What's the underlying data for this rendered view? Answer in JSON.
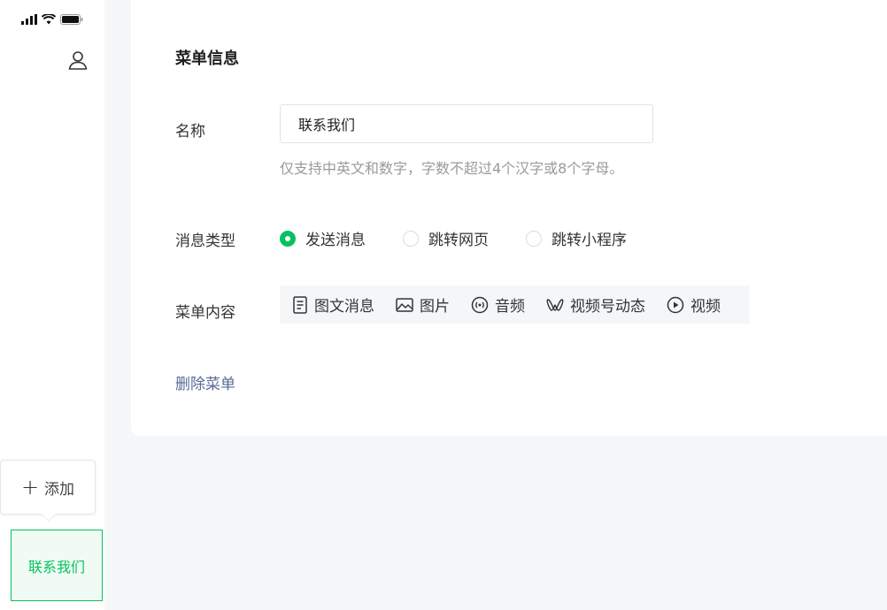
{
  "phone": {
    "status_icons": [
      "signal-icon",
      "wifi-icon",
      "battery-icon"
    ],
    "profile_icon": "user-icon",
    "add_button": {
      "icon": "plus-icon",
      "label": "添加"
    },
    "menu_tab": {
      "label": "联系我们"
    }
  },
  "panel": {
    "title": "菜单信息",
    "name": {
      "label": "名称",
      "value": "联系我们",
      "hint": "仅支持中英文和数字，字数不超过4个汉字或8个字母。"
    },
    "message_type": {
      "label": "消息类型",
      "options": [
        {
          "label": "发送消息",
          "checked": true
        },
        {
          "label": "跳转网页",
          "checked": false
        },
        {
          "label": "跳转小程序",
          "checked": false
        }
      ]
    },
    "menu_content": {
      "label": "菜单内容",
      "items": [
        {
          "label": "图文消息",
          "icon": "article-icon"
        },
        {
          "label": "图片",
          "icon": "image-icon"
        },
        {
          "label": "音频",
          "icon": "audio-icon"
        },
        {
          "label": "视频号动态",
          "icon": "channels-icon"
        },
        {
          "label": "视频",
          "icon": "video-icon"
        }
      ]
    },
    "delete_label": "删除菜单"
  },
  "colors": {
    "accent": "#07c160",
    "link": "#576b95",
    "hint": "#9a9a9a",
    "background": "#f6f7f9"
  }
}
